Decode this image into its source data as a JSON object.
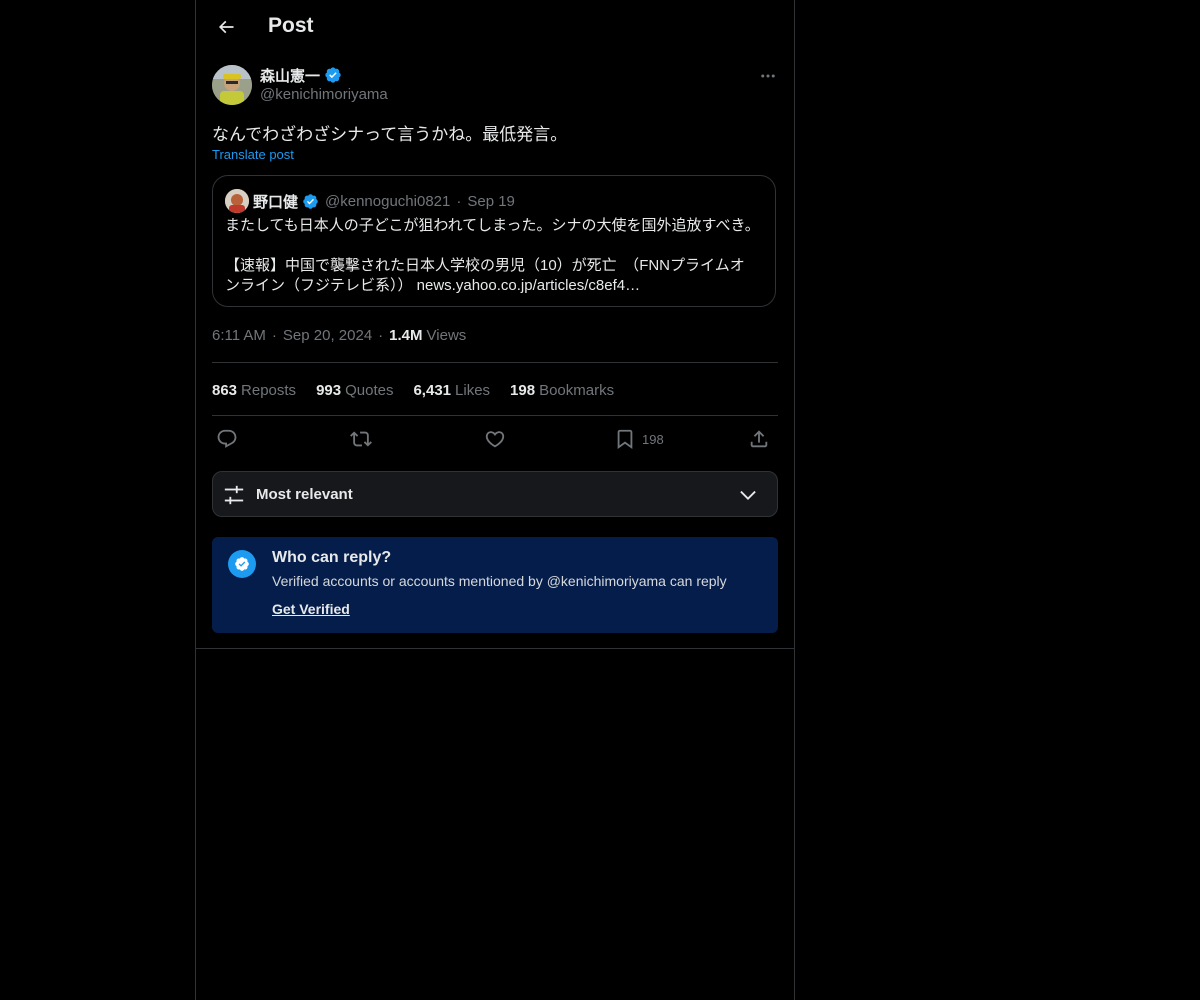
{
  "header": {
    "title": "Post"
  },
  "author": {
    "name": "森山憲一",
    "handle": "@kenichimoriyama"
  },
  "post": {
    "text": "なんでわざわざシナって言うかね。最低発言。",
    "translate_label": "Translate post"
  },
  "quote": {
    "name": "野口健",
    "handle": "@kennoguchi0821",
    "dot": "·",
    "date": "Sep 19",
    "line1": "またしても日本人の子どこが狙われてしまった。シナの大使を国外追放すべき。",
    "line2": "【速報】中国で襲撃された日本人学校の男児（10）が死亡　（FNNプライムオ",
    "line3": "ンライン（フジテレビ系））  news.yahoo.co.jp/articles/c8ef4…"
  },
  "meta": {
    "time": "6:11 AM",
    "dot1": "·",
    "date": "Sep 20, 2024",
    "dot2": "·",
    "views_count": "1.4M",
    "views_label": "Views"
  },
  "stats": {
    "reposts_count": "863",
    "reposts_label": "Reposts",
    "quotes_count": "993",
    "quotes_label": "Quotes",
    "likes_count": "6,431",
    "likes_label": "Likes",
    "bookmarks_count": "198",
    "bookmarks_label": "Bookmarks"
  },
  "actions": {
    "bookmark_count": "198"
  },
  "sort": {
    "label": "Most relevant"
  },
  "reply_notice": {
    "title": "Who can reply?",
    "description": "Verified accounts or accounts mentioned by @kenichimoriyama can reply",
    "link": "Get Verified"
  },
  "icons": {
    "back": "arrow-left-icon",
    "verified": "verified-badge-icon",
    "more": "more-horizontal-icon",
    "reply": "reply-icon",
    "repost": "repost-icon",
    "like": "heart-icon",
    "bookmark": "bookmark-icon",
    "share": "share-icon",
    "sort": "sliders-icon",
    "chevron": "chevron-down-icon"
  },
  "colors": {
    "accent": "#1d9bf0",
    "background": "#000000",
    "notice_background": "#051d4a"
  }
}
